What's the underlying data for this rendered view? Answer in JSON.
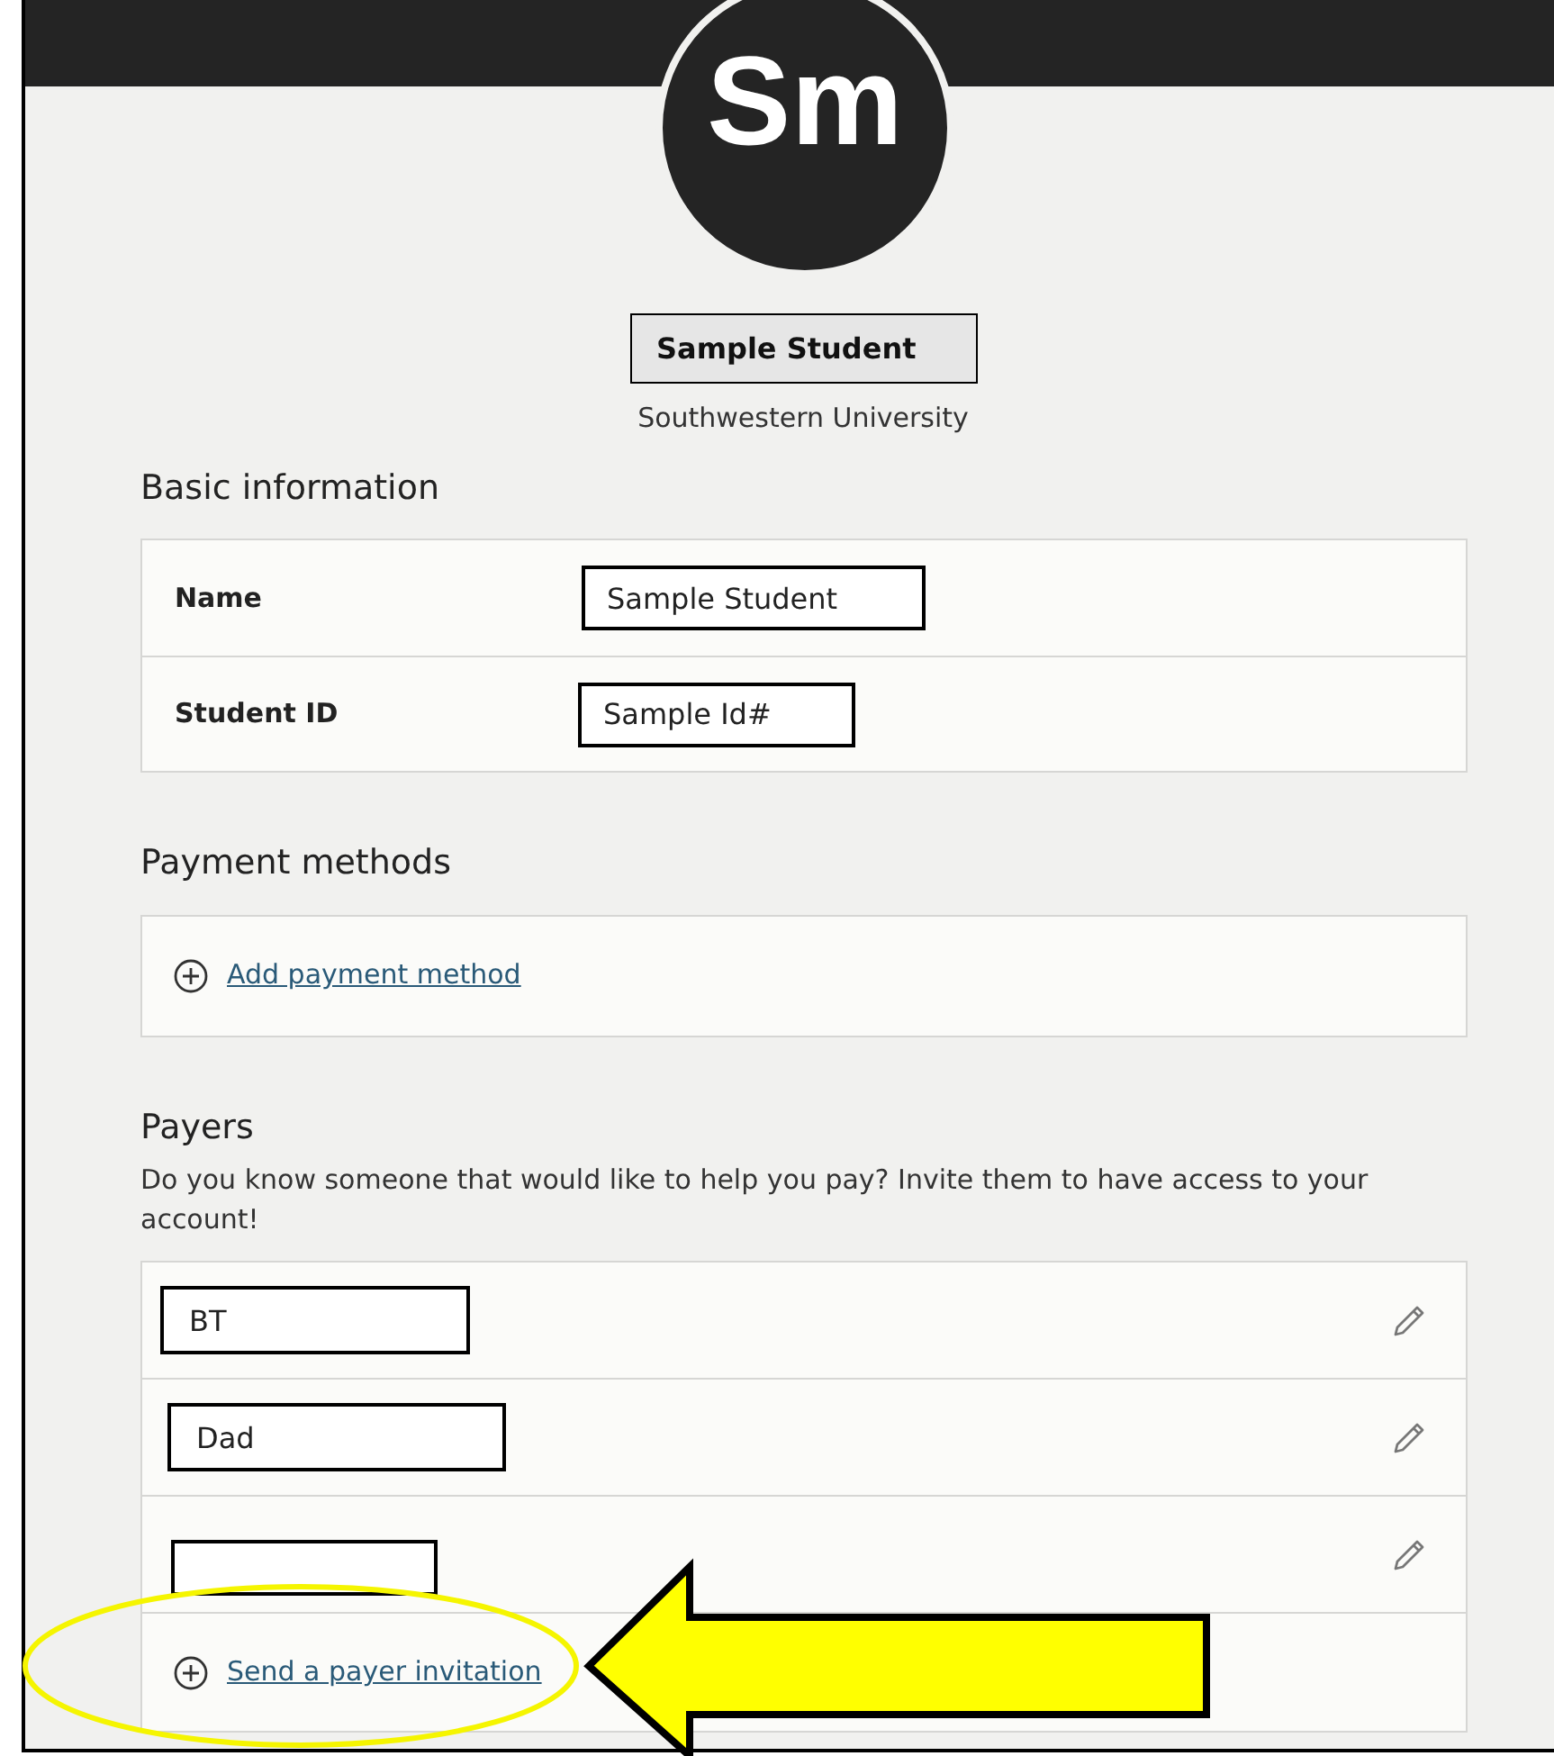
{
  "header": {
    "avatar_initials": "Sm",
    "display_name": "Sample Student",
    "school": "Southwestern University"
  },
  "basic_information": {
    "title": "Basic information",
    "rows": [
      {
        "label": "Name",
        "value": "Sample Student"
      },
      {
        "label": "Student ID",
        "value": "Sample Id#"
      }
    ]
  },
  "payment_methods": {
    "title": "Payment methods",
    "add_link": "Add payment method"
  },
  "payers": {
    "title": "Payers",
    "description": "Do you know someone that would like to help you pay? Invite them to have access to your account!",
    "items": [
      {
        "kind": "input",
        "value": "BT"
      },
      {
        "kind": "input",
        "value": "Dad"
      },
      {
        "kind": "input"
      }
    ],
    "invite_link": "Send a payer invitation"
  }
}
